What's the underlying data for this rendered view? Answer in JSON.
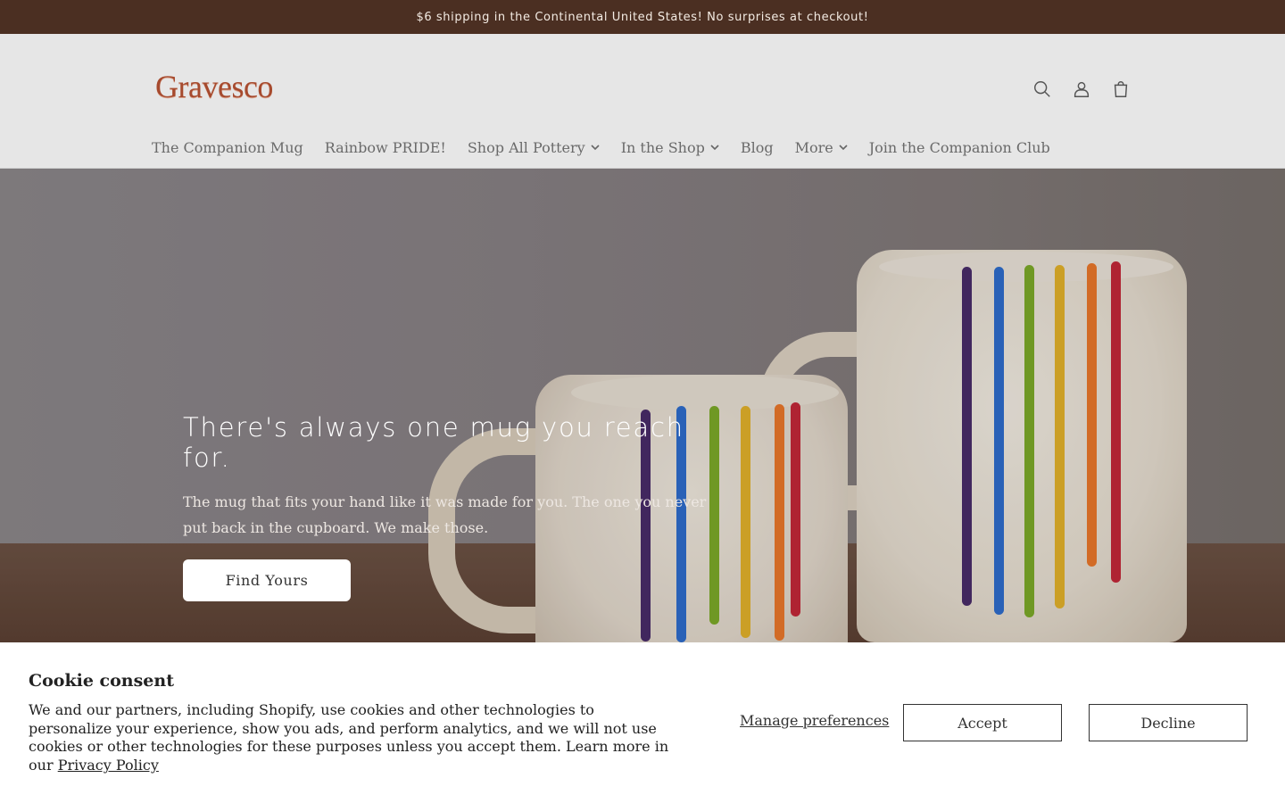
{
  "announcement": {
    "text": "$6 shipping in the Continental United States! No surprises at checkout!"
  },
  "header": {
    "logo": "Gravesco",
    "icons": [
      "search-icon",
      "account-icon",
      "cart-icon"
    ]
  },
  "nav": {
    "items": [
      {
        "label": "The Companion Mug",
        "dropdown": false
      },
      {
        "label": "Rainbow PRIDE!",
        "dropdown": false
      },
      {
        "label": "Shop All Pottery",
        "dropdown": true
      },
      {
        "label": "In the Shop",
        "dropdown": true
      },
      {
        "label": "Blog",
        "dropdown": false
      },
      {
        "label": "More",
        "dropdown": true
      },
      {
        "label": "Join the Companion Club",
        "dropdown": false
      }
    ]
  },
  "hero": {
    "title": "There's always one mug you reach for.",
    "subtitle": "The mug that fits your hand like it was made for you. The one you never put back in the cupboard. We make those.",
    "button": "Find Yours"
  },
  "cookie": {
    "title": "Cookie consent",
    "text": "We and our partners, including Shopify, use cookies and other technologies to personalize your experience, show you ads, and perform analytics, and we will not use cookies or other technologies for these purposes unless you accept them. Learn more in our",
    "link": "Privacy Policy",
    "manage": "Manage preferences",
    "accept": "Accept",
    "decline": "Decline"
  },
  "colors": {
    "announcement_bg": "#4b2f22",
    "header_bg": "#e6e6e6",
    "logo": "#a64a2e",
    "drips": [
      "#4a2d6b",
      "#2f6fd1",
      "#7fae2a",
      "#e8b52c",
      "#f07a2c",
      "#c8283a"
    ]
  }
}
